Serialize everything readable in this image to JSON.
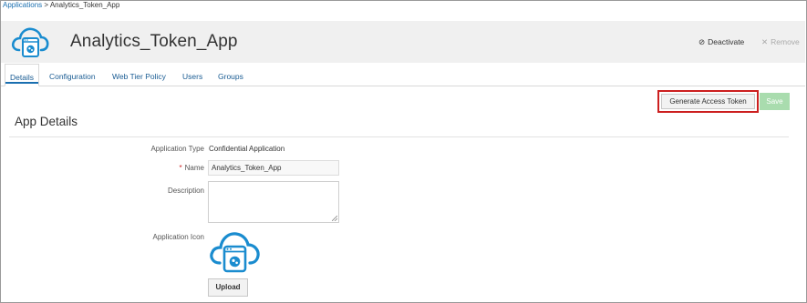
{
  "breadcrumb": {
    "root": "Applications",
    "separator": " > ",
    "current": "Analytics_Token_App"
  },
  "header": {
    "title": "Analytics_Token_App",
    "app_icon": "cloud-app-icon",
    "deactivate_label": "Deactivate",
    "deactivate_icon": "⊘",
    "remove_label": "Remove",
    "remove_icon": "✕"
  },
  "tabs": [
    {
      "label": "Details",
      "active": true
    },
    {
      "label": "Configuration",
      "active": false
    },
    {
      "label": "Web Tier Policy",
      "active": false
    },
    {
      "label": "Users",
      "active": false
    },
    {
      "label": "Groups",
      "active": false
    }
  ],
  "actions": {
    "generate_label": "Generate Access Token",
    "save_label": "Save"
  },
  "section": {
    "title": "App Details"
  },
  "form": {
    "app_type_label": "Application Type",
    "app_type_value": "Confidential Application",
    "required_mark": "*",
    "name_label": "Name",
    "name_value": "Analytics_Token_App",
    "description_label": "Description",
    "description_value": "",
    "icon_label": "Application Icon",
    "upload_label": "Upload"
  },
  "colors": {
    "brand_blue": "#1a8ccf",
    "link_blue": "#1a5c93",
    "highlight_red": "#cc1f1f",
    "save_disabled_green": "#a9dcae",
    "header_bg": "#f0f0f0"
  }
}
